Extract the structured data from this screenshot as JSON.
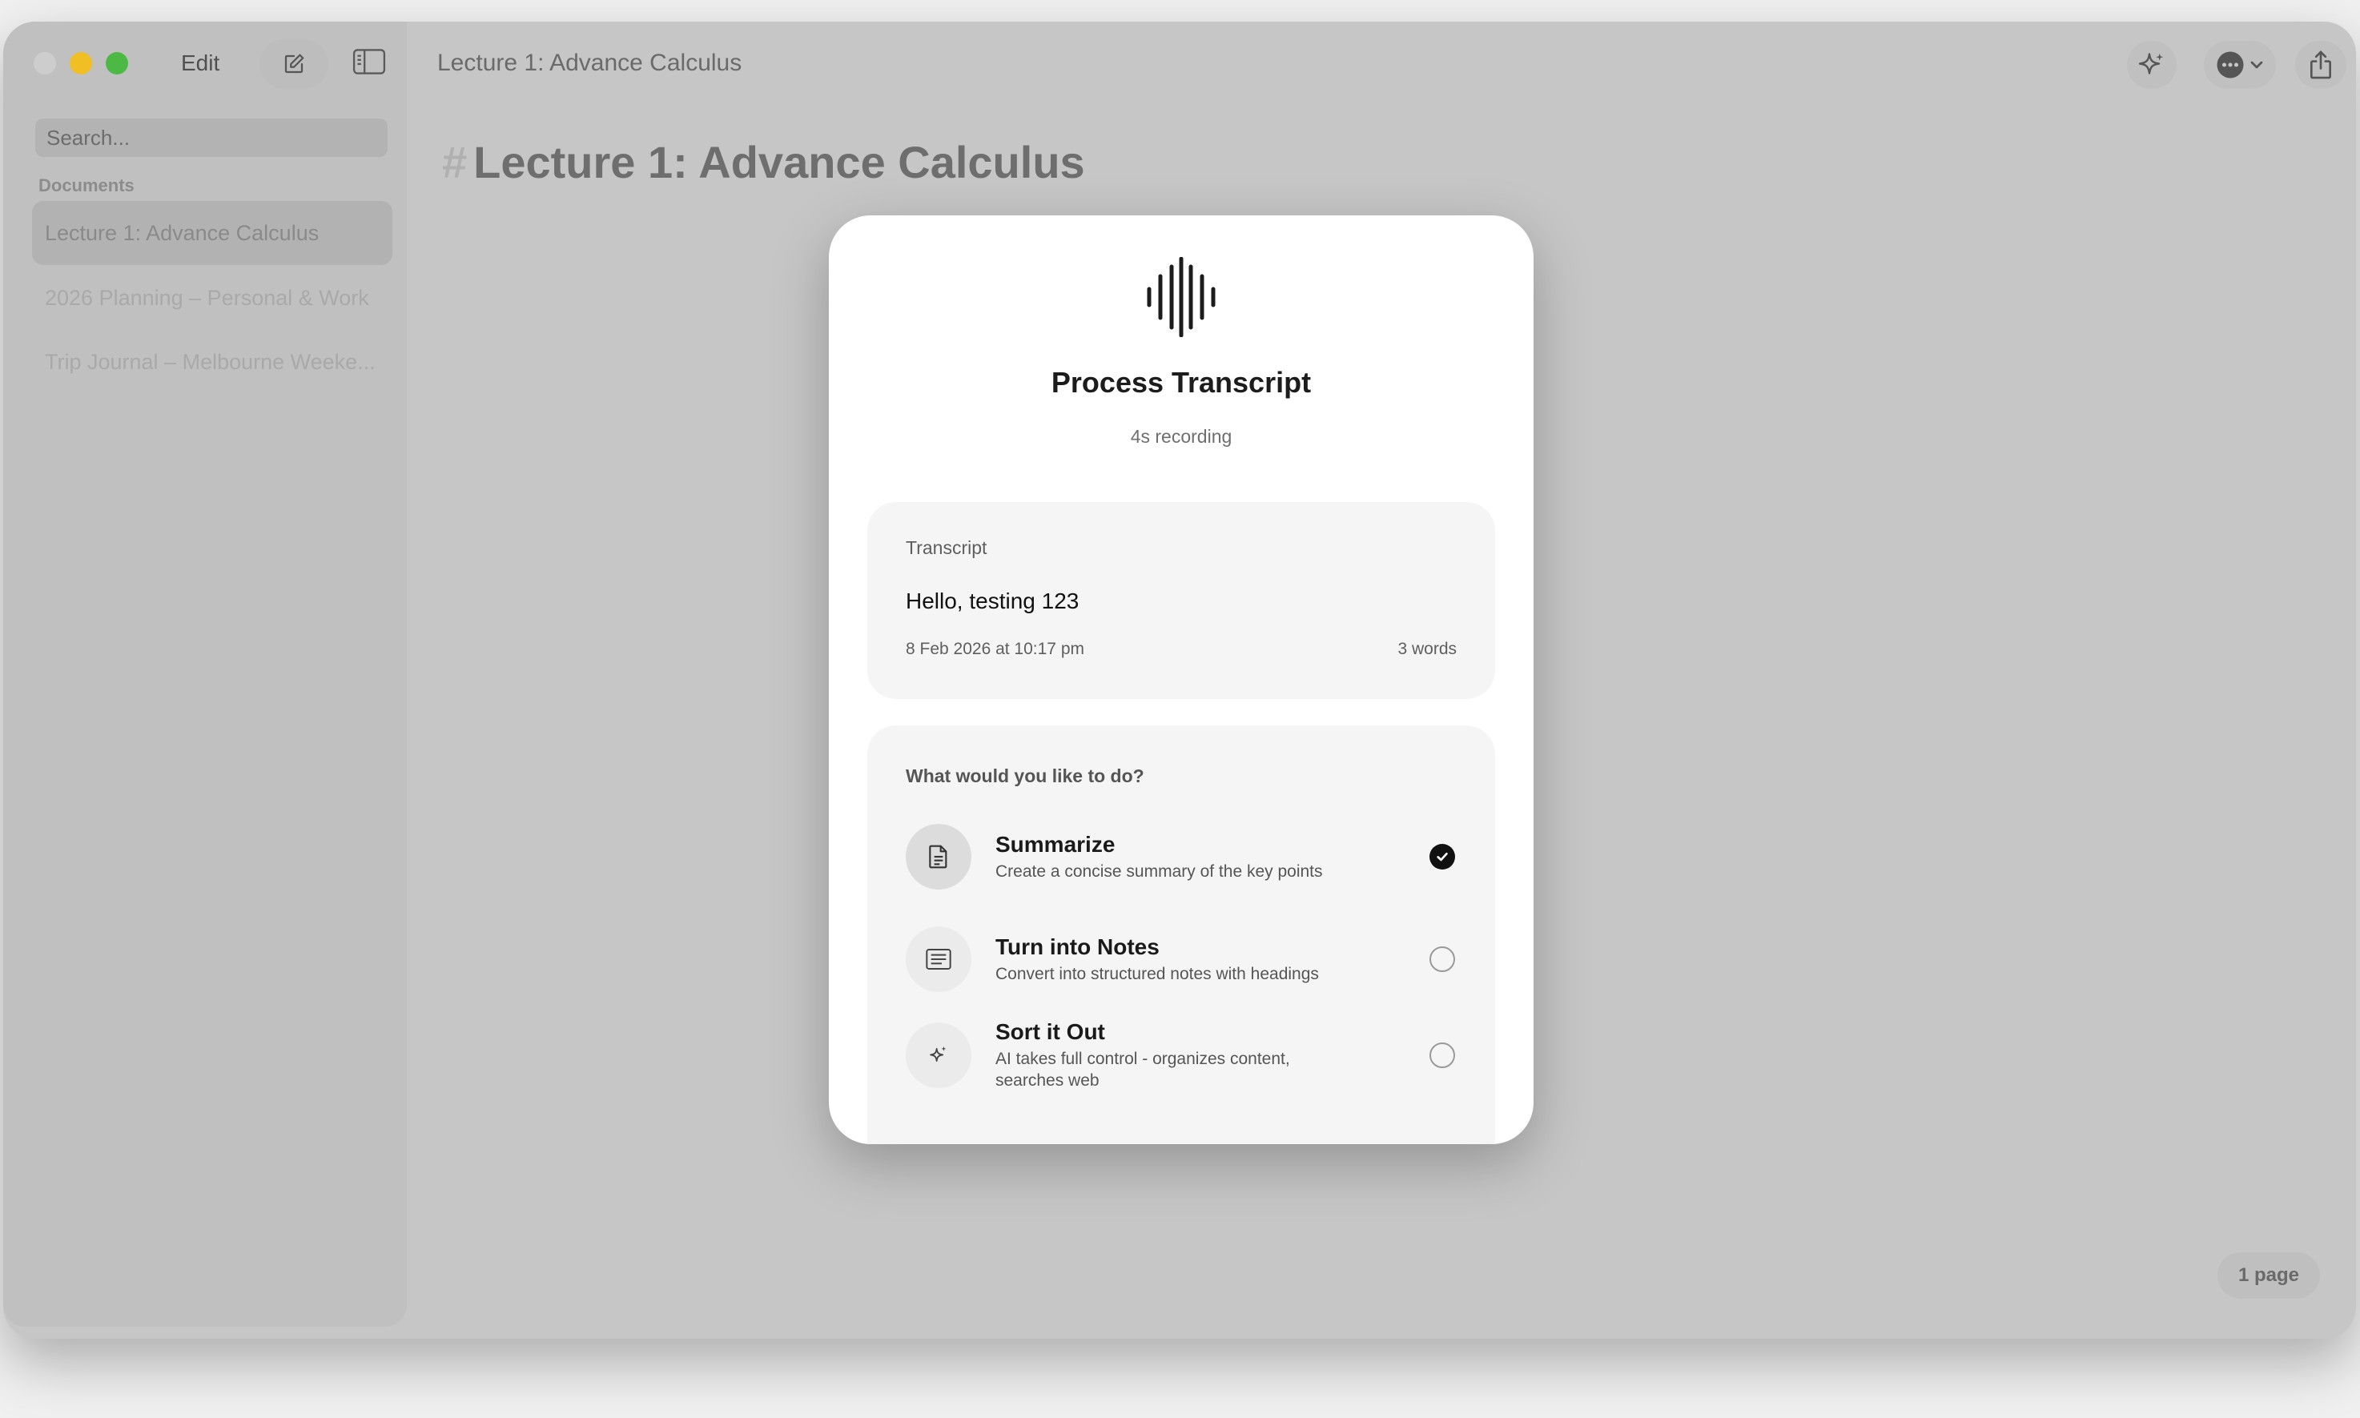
{
  "window": {
    "edit_label": "Edit",
    "title": "Lecture 1: Advance Calculus"
  },
  "sidebar": {
    "search_placeholder": "Search...",
    "section_label": "Documents",
    "items": [
      {
        "label": "Lecture 1: Advance Calculus",
        "selected": true
      },
      {
        "label": "2026 Planning – Personal & Work",
        "selected": false
      },
      {
        "label": "Trip Journal – Melbourne Weeke...",
        "selected": false
      }
    ]
  },
  "document": {
    "heading_marker": "#",
    "heading": "Lecture 1: Advance Calculus",
    "page_count": "1 page"
  },
  "modal": {
    "icon": "waveform-icon",
    "title": "Process Transcript",
    "subtitle": "4s recording",
    "transcript": {
      "label": "Transcript",
      "text": "Hello, testing 123",
      "date": "8 Feb 2026 at 10:17 pm",
      "word_count": "3 words"
    },
    "options_prompt": "What would you like to do?",
    "options": [
      {
        "title": "Summarize",
        "description": "Create a concise summary of the key points",
        "icon": "document-icon",
        "selected": true
      },
      {
        "title": "Turn into Notes",
        "description": "Convert into structured notes with headings",
        "icon": "notes-list-icon",
        "selected": false
      },
      {
        "title": "Sort it Out",
        "description": "AI takes full control - organizes content, searches web",
        "icon": "sparkle-icon",
        "selected": false
      }
    ]
  }
}
